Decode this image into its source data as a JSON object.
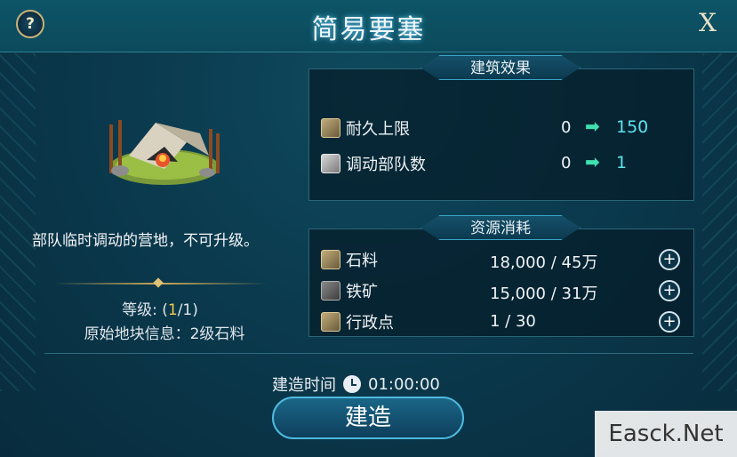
{
  "header": {
    "title": "简易要塞",
    "help_label": "?",
    "close_label": "X"
  },
  "building": {
    "description": "部队临时调动的营地，不可升级。",
    "level_prefix": "等级: (",
    "level_current": "1",
    "level_suffix": "/1)",
    "origin_info": "原始地块信息：2级石料"
  },
  "effects": {
    "title": "建筑效果",
    "rows": [
      {
        "icon": "durability-icon",
        "label": "耐久上限",
        "from": "0",
        "to": "150"
      },
      {
        "icon": "troop-icon",
        "label": "调动部队数",
        "from": "0",
        "to": "1"
      }
    ]
  },
  "resources": {
    "title": "资源消耗",
    "rows": [
      {
        "icon": "stone-icon",
        "label": "石料",
        "value": "18,000 / 45万"
      },
      {
        "icon": "iron-icon",
        "label": "铁矿",
        "value": "15,000 / 31万"
      },
      {
        "icon": "admin-point-icon",
        "label": "行政点",
        "value": "1 / 30"
      }
    ]
  },
  "footer": {
    "time_label": "建造时间",
    "time_value": "01:00:00",
    "build_label": "建造"
  },
  "watermark": "Easck.Net",
  "colors": {
    "accent": "#3fe0b0",
    "new_value": "#5fe3ef",
    "highlight": "#f2c94c"
  }
}
